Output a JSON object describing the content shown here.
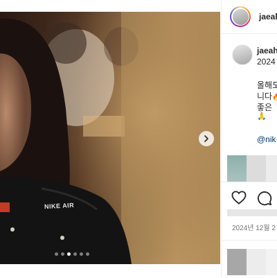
{
  "post": {
    "image_alt_brand": "NIKE AIR",
    "carousel": {
      "slide_count": 6,
      "active_index": 2
    }
  },
  "header": {
    "username": "jaeah"
  },
  "caption": {
    "username": "jaeah",
    "year": "2024",
    "line1": "올해도",
    "line2": "니다",
    "line3": "좋은 ",
    "mention": "@nik"
  },
  "meta": {
    "date": "2024년 12월 2"
  },
  "icons": {
    "next": "chevron-right-icon",
    "like": "heart-icon",
    "comment": "comment-icon",
    "emoji1": "fire-emoji",
    "emoji2": "praying-hands-emoji"
  },
  "colors": {
    "mention": "#00376b",
    "date": "#737373",
    "text": "#262626"
  }
}
